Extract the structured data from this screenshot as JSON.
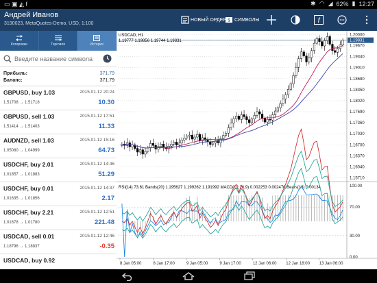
{
  "status": {
    "left_icons": [
      "screen-icon",
      "image-icon",
      "brand-icon",
      "facebook-icon"
    ],
    "battery": "62%",
    "time": "12:27"
  },
  "header": {
    "account_name": "Андрей Иванов",
    "account_info": "3190023, MetaQuotes-Demo, USD, 1:100",
    "new_order_label": "НОВЫЙ ОРДЕР",
    "symbols_label": "СИМВОЛЫ"
  },
  "tabs": [
    {
      "label": "Котировки",
      "icon": "quotes-icon"
    },
    {
      "label": "Торговля",
      "icon": "trade-icon"
    },
    {
      "label": "История",
      "icon": "history-icon"
    }
  ],
  "search": {
    "placeholder": "Введите название символа"
  },
  "summary": {
    "profit_label": "Прибыль:",
    "profit_value": "371.79",
    "balance_label": "Баланс:",
    "balance_value": "371.79"
  },
  "trades": [
    {
      "title": "GBPUSD, buy 1.03",
      "date": "2015.01.12 20:24",
      "prices": "1.51708 → 1.51718",
      "profit": "10.30",
      "negative": false
    },
    {
      "title": "GBPUSD, sell 1.03",
      "date": "2015.01.12 17:51",
      "prices": "1.51414 → 1.51403",
      "profit": "11.33",
      "negative": false
    },
    {
      "title": "AUDNZD, sell 1.03",
      "date": "2015.01.12 15:16",
      "prices": "1.05080 → 1.04999",
      "profit": "64.73",
      "negative": false
    },
    {
      "title": "USDCHF, buy 2.01",
      "date": "2015.01.12 14:46",
      "prices": "1.01857 → 1.01883",
      "profit": "51.29",
      "negative": false
    },
    {
      "title": "USDCHF, buy 0.01",
      "date": "2015.01.12 14:37",
      "prices": "1.01635 → 1.01856",
      "profit": "2.17",
      "negative": false
    },
    {
      "title": "USDCHF, buy 2.21",
      "date": "2015.01.12 12:51",
      "prices": "1.01678 → 1.01780",
      "profit": "221.48",
      "negative": false
    },
    {
      "title": "USDCAD, sell 0.01",
      "date": "2015.01.12 12:46",
      "prices": "1.18796 → 1.18837",
      "profit": "-0.35",
      "negative": true
    },
    {
      "title": "USDCAD, buy 0.92",
      "date": "",
      "prices": "",
      "profit": "",
      "negative": false
    }
  ],
  "chart": {
    "symbol": "USDCAD, H1",
    "ohlc_text": "1.19777 1.19856 1.19744 1.19831",
    "price_ticks": [
      "1.20000",
      "1.19831",
      "1.19670",
      "1.19340",
      "1.19010",
      "1.18680",
      "1.18350",
      "1.18020",
      "1.17690",
      "1.17360",
      "1.17030",
      "1.16700",
      "1.16370",
      "1.16040",
      "1.15710"
    ],
    "current_price": "1.19831",
    "indicator_text": "RSI(14) 73.61 Bands(20) 1.195627 1.199262 1.191992 MACD(12,26,9) 0.002253 0.002470 Bears(13) 0.00134",
    "ind_ticks": [
      "100.00",
      "70.00",
      "30.00",
      "0.00"
    ],
    "time_labels": [
      "8 Jan 05:00",
      "8 Jan 17:00",
      "9 Jan 05:00",
      "9 Jan 17:00",
      "12 Jan 06:00",
      "12 Jan 18:00",
      "13 Jan 06:00"
    ]
  },
  "chart_data": {
    "type": "candlestick",
    "title": "USDCAD, H1",
    "ylim": [
      1.157,
      1.2005
    ],
    "closes": [
      1.1672,
      1.1668,
      1.1676,
      1.1664,
      1.167,
      1.1659,
      1.1648,
      1.1655,
      1.1642,
      1.165,
      1.1661,
      1.1674,
      1.1668,
      1.1657,
      1.1665,
      1.1672,
      1.1663,
      1.1658,
      1.1666,
      1.1672,
      1.1678,
      1.1669,
      1.1675,
      1.1684,
      1.169,
      1.1696,
      1.1699,
      1.1687,
      1.1693,
      1.1701,
      1.1682,
      1.1691,
      1.1684,
      1.1679,
      1.1671,
      1.1675,
      1.1683,
      1.1676,
      1.1688,
      1.1698,
      1.1705,
      1.1721,
      1.1735,
      1.1748,
      1.1756,
      1.1746,
      1.176,
      1.1754,
      1.1745,
      1.1736,
      1.1747,
      1.1758,
      1.1769,
      1.1762,
      1.1749,
      1.1738,
      1.1746,
      1.1744,
      1.176,
      1.1771,
      1.1781,
      1.1793,
      1.1807,
      1.182,
      1.1836,
      1.1853,
      1.1877,
      1.1902,
      1.1928,
      1.1948,
      1.1936,
      1.1918,
      1.1931,
      1.1952,
      1.1974,
      1.1988,
      1.1979,
      1.1966,
      1.1982,
      1.1994,
      1.1971,
      1.1952,
      1.1947,
      1.1958,
      1.1969,
      1.1983
    ]
  }
}
